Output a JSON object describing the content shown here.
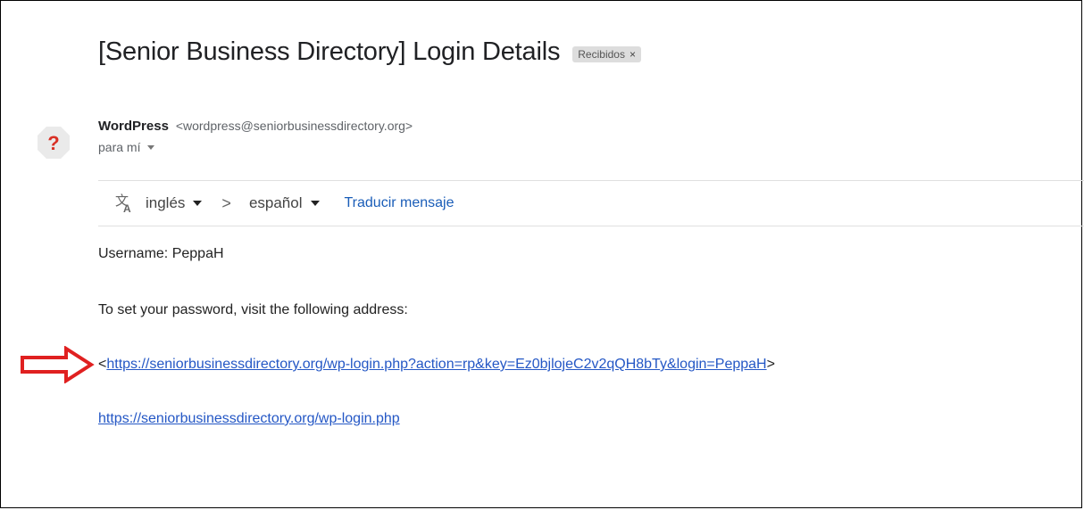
{
  "email": {
    "subject": "[Senior Business Directory] Login Details",
    "label": {
      "text": "Recibidos",
      "remove_glyph": "×"
    },
    "sender": {
      "name": "WordPress",
      "email": "<wordpress@seniorbusinessdirectory.org>",
      "avatar_glyph": "?"
    },
    "recipient": "para mí"
  },
  "translate_bar": {
    "icon": "translate-icon",
    "from_language": "inglés",
    "separator": ">",
    "to_language": "español",
    "action_label": "Traducir mensaje"
  },
  "body": {
    "username_line": "Username: PeppaH",
    "instructions": "To set your password, visit the following address:",
    "reset_link_open": "<",
    "reset_link": "https://seniorbusinessdirectory.org/wp-login.php?action=rp&key=Ez0bjlojeC2v2qQH8bTy&login=PeppaH",
    "reset_link_close": ">",
    "login_link": "https://seniorbusinessdirectory.org/wp-login.php"
  },
  "annotation": {
    "arrow_icon": "red-outline-arrow-icon",
    "color": "#e02020"
  },
  "colors": {
    "link": "#2457c5",
    "translate_link": "#1a5db8",
    "label_chip_bg": "#dddddd"
  }
}
